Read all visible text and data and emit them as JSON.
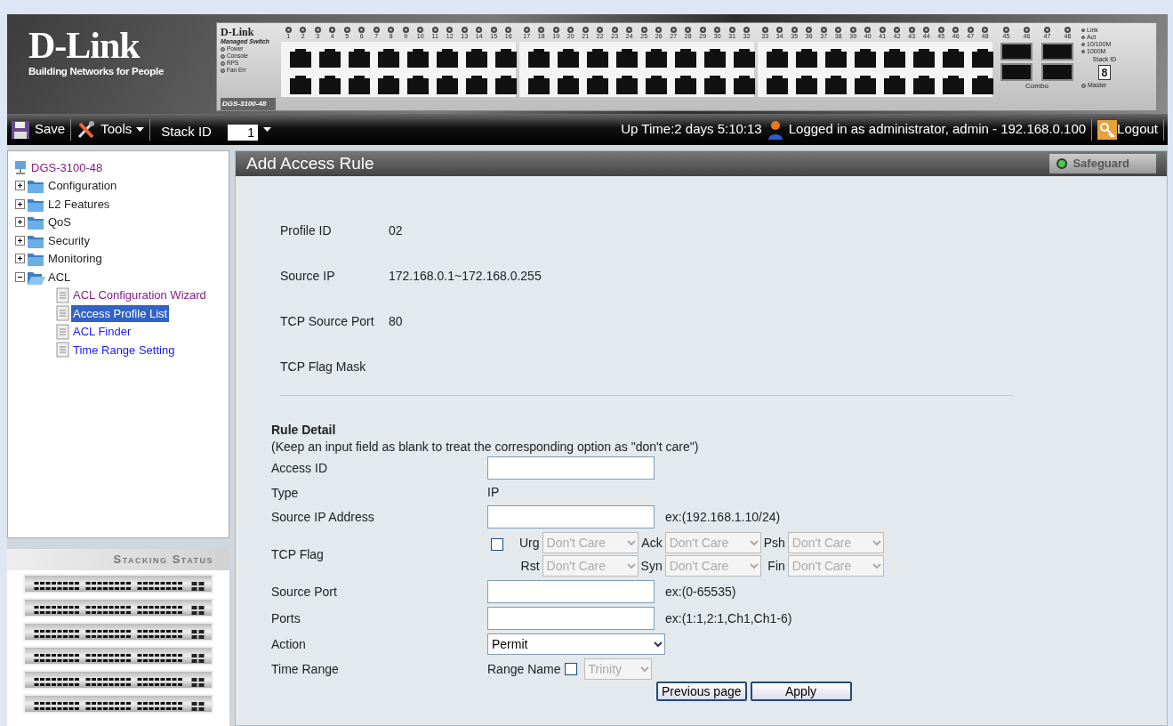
{
  "banner": {
    "logo": "D-Link",
    "tagline": "Building Networks for People",
    "panel": {
      "brand": "D-Link",
      "subtitle": "Managed Switch",
      "leds": [
        "Power",
        "Console",
        "RPS",
        "Fan Err"
      ],
      "model": "DGS-3100-48",
      "port_groups": [
        {
          "numbers": [
            "1",
            "2",
            "3",
            "4",
            "5",
            "6",
            "7",
            "8",
            "9",
            "10",
            "11",
            "12",
            "13",
            "14",
            "15",
            "16"
          ]
        },
        {
          "numbers": [
            "17",
            "18",
            "19",
            "20",
            "21",
            "22",
            "23",
            "24",
            "25",
            "26",
            "27",
            "28",
            "29",
            "30",
            "31",
            "32"
          ]
        },
        {
          "numbers": [
            "33",
            "34",
            "35",
            "36",
            "37",
            "38",
            "39",
            "40",
            "41",
            "42",
            "43",
            "44",
            "45",
            "46",
            "47",
            "48"
          ]
        }
      ],
      "combo_groups": [
        {
          "numbers": [
            "45",
            "46"
          ]
        },
        {
          "numbers": [
            "47",
            "48"
          ]
        }
      ],
      "combo_label": "Combo",
      "legend": [
        "Link",
        "Act",
        "10/100M",
        "1000M"
      ],
      "stack_id_label": "Stack ID",
      "stack_digit": "8",
      "master_label": "Master"
    }
  },
  "toolbar": {
    "save": "Save",
    "tools": "Tools",
    "stack_id_label": "Stack ID",
    "stack_id_value": "1",
    "uptime": "Up Time:2 days 5:10:13",
    "login": "Logged in as administrator, admin - 192.168.0.100",
    "logout": "Logout"
  },
  "tree": {
    "label": "DGS-3100-48",
    "children": [
      {
        "label": "Configuration",
        "expanded": false
      },
      {
        "label": "L2 Features",
        "expanded": false
      },
      {
        "label": "QoS",
        "expanded": false
      },
      {
        "label": "Security",
        "expanded": false
      },
      {
        "label": "Monitoring",
        "expanded": false
      },
      {
        "label": "ACL",
        "expanded": true,
        "children": [
          {
            "label": "ACL Configuration Wizard",
            "selected": false,
            "visited": true
          },
          {
            "label": "Access Profile List",
            "selected": true,
            "visited": false
          },
          {
            "label": "ACL Finder",
            "selected": false,
            "visited": false
          },
          {
            "label": "Time Range Setting",
            "selected": false,
            "visited": false
          }
        ]
      }
    ]
  },
  "stacking": {
    "title": "Stacking Status"
  },
  "page": {
    "title": "Add Access Rule",
    "safeguard": {
      "label": "Safeguard",
      "on": true
    },
    "profile": [
      {
        "label": "Profile ID",
        "value": "02"
      },
      {
        "label": "Source IP",
        "value": "172.168.0.1~172.168.0.255"
      },
      {
        "label": "TCP Source Port",
        "value": "80"
      },
      {
        "label": "TCP Flag Mask"
      }
    ],
    "rule_title": "Rule Detail",
    "rule_note": "(Keep an input field as blank to treat the corresponding option as \"don't care\")",
    "rows": [
      {
        "kind": "input",
        "label": "Access ID"
      },
      {
        "kind": "text",
        "label": "Type",
        "value": "IP"
      },
      {
        "kind": "input",
        "label": "Source IP Address",
        "hint": "ex:(192.168.1.10/24)"
      },
      {
        "kind": "flags",
        "label": "TCP Flag",
        "checked": false,
        "flags": [
          {
            "label": "Urg",
            "value": "Don't Care",
            "disabled": true
          },
          {
            "label": "Ack",
            "value": "Don't Care",
            "disabled": true
          },
          {
            "label": "Psh",
            "value": "Don't Care",
            "disabled": true
          },
          {
            "label": "Rst",
            "value": "Don't Care",
            "disabled": true
          },
          {
            "label": "Syn",
            "value": "Don't Care",
            "disabled": true
          },
          {
            "label": "Fin",
            "value": "Don't Care",
            "disabled": true
          }
        ]
      },
      {
        "kind": "input",
        "label": "Source Port",
        "hint": "ex:(0-65535)"
      },
      {
        "kind": "input",
        "label": "Ports",
        "hint": "ex:(1:1,2:1,Ch1,Ch1-6)"
      },
      {
        "kind": "select",
        "label": "Action",
        "value": "Permit",
        "disabled": false
      },
      {
        "kind": "range",
        "label": "Time Range",
        "range_label": "Range Name",
        "checked": false,
        "value": "Trinity",
        "disabled": true
      }
    ],
    "buttons": [
      "Previous page",
      "Apply"
    ]
  }
}
